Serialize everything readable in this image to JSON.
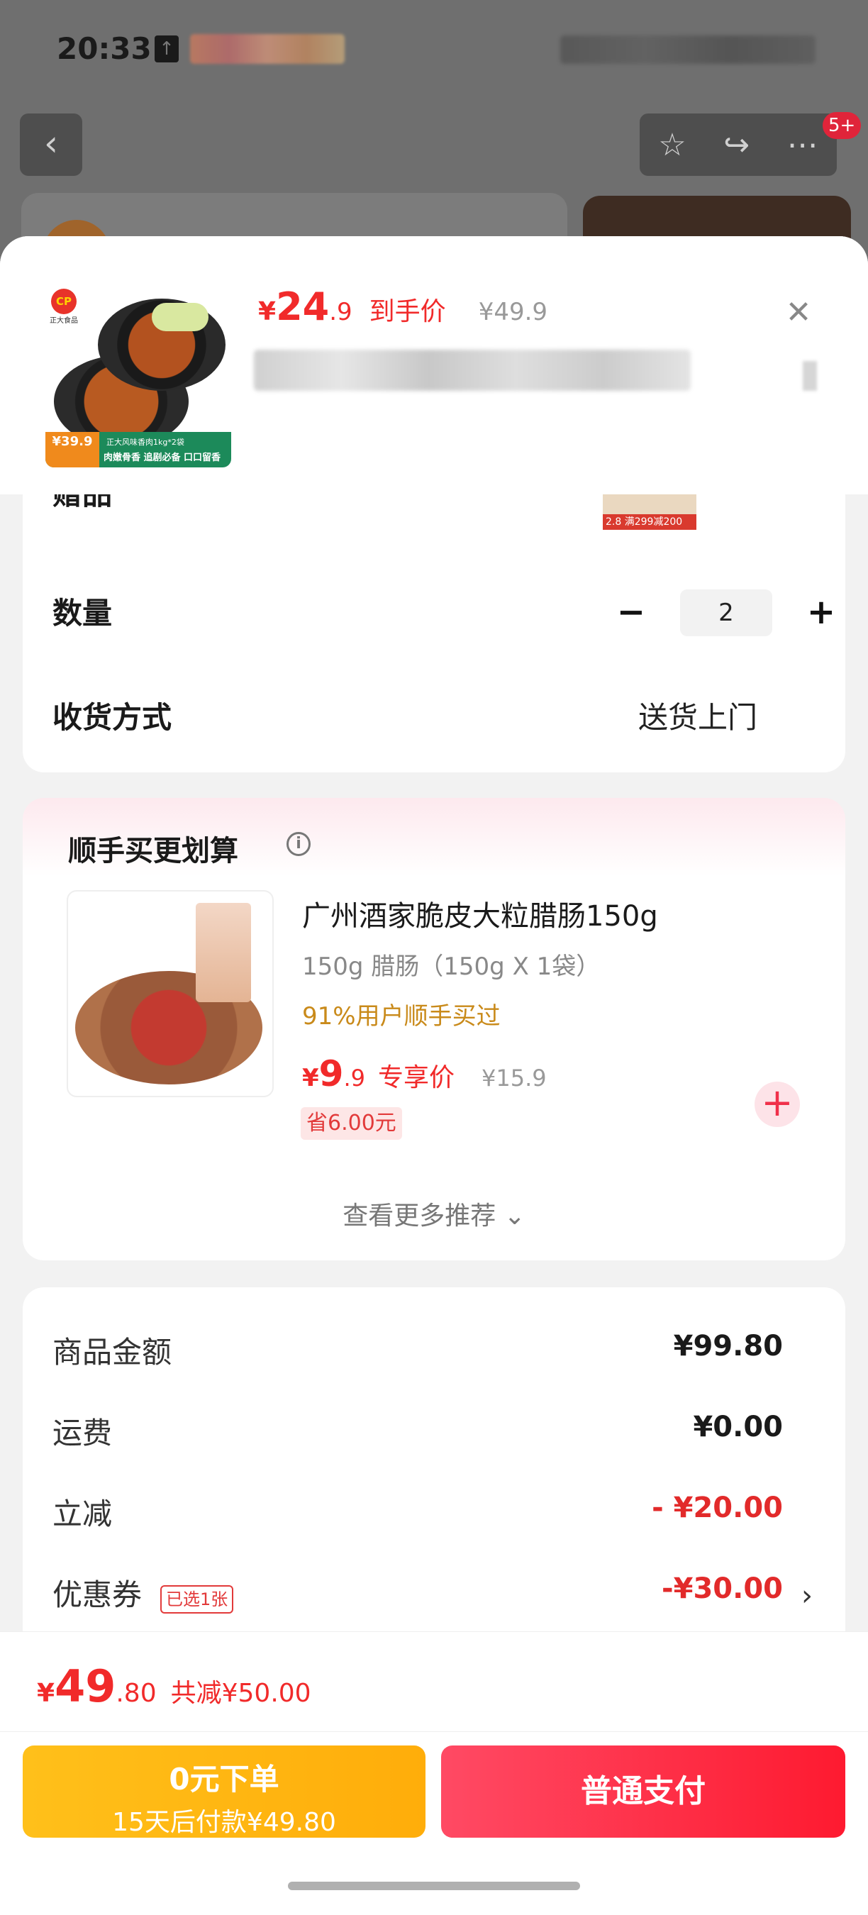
{
  "status_bar": {
    "time": "20:33"
  },
  "topbar": {
    "badge": "5+"
  },
  "product": {
    "price_currency": "¥",
    "price_integer": "24",
    "price_decimal": ".9",
    "price_label": "到手价",
    "original_price": "¥49.9",
    "image_badge_price": "¥39.9",
    "image_banner_line1": "正大风味香肉1kg*2袋",
    "image_banner_line2": "肉嫩骨香 追剧必备 口口留香",
    "brand_text": "正大食品"
  },
  "selection": {
    "partial_label": "赠品",
    "partial_thumb_price": "2.8",
    "partial_thumb_text": "满299减200",
    "quantity_label": "数量",
    "quantity_value": "2",
    "minus_symbol": "−",
    "plus_symbol": "+",
    "shipping_label": "收货方式",
    "shipping_value": "送货上门"
  },
  "addon": {
    "title": "顺手买更划算",
    "name": "广州酒家脆皮大粒腊肠150g",
    "spec": "150g 腊肠（150g X 1袋）",
    "social_proof": "91%用户顺手买过",
    "price_currency": "¥",
    "price_integer": "9",
    "price_decimal": ".9",
    "price_label": "专享价",
    "original_price": "¥15.9",
    "save_text": "省6.00元",
    "more_label": "查看更多推荐 ⌄"
  },
  "summary": {
    "rows": [
      {
        "label": "商品金额",
        "value": "¥99.80"
      },
      {
        "label": "运费",
        "value": "¥0.00"
      },
      {
        "label": "立减",
        "value": "- ¥20.00"
      },
      {
        "label": "优惠券",
        "value": "-¥30.00"
      }
    ],
    "coupon_tag": "已选1张"
  },
  "bottom": {
    "total_currency": "¥",
    "total_integer": "49",
    "total_decimal": ".80",
    "total_saved": "共减¥50.00",
    "pay_later_title": "0元下单",
    "pay_later_sub": "15天后付款¥49.80",
    "pay_button": "普通支付"
  },
  "colors": {
    "accent_red": "#f12a2a",
    "pay_button": "#fe1a30",
    "pay_later_button": "#ffb20e",
    "social_proof": "#c98a1a"
  },
  "icons": [
    "back-icon",
    "star-icon",
    "share-icon",
    "more-icon",
    "close-icon",
    "info-icon",
    "plus-icon",
    "chevron-right-icon"
  ]
}
